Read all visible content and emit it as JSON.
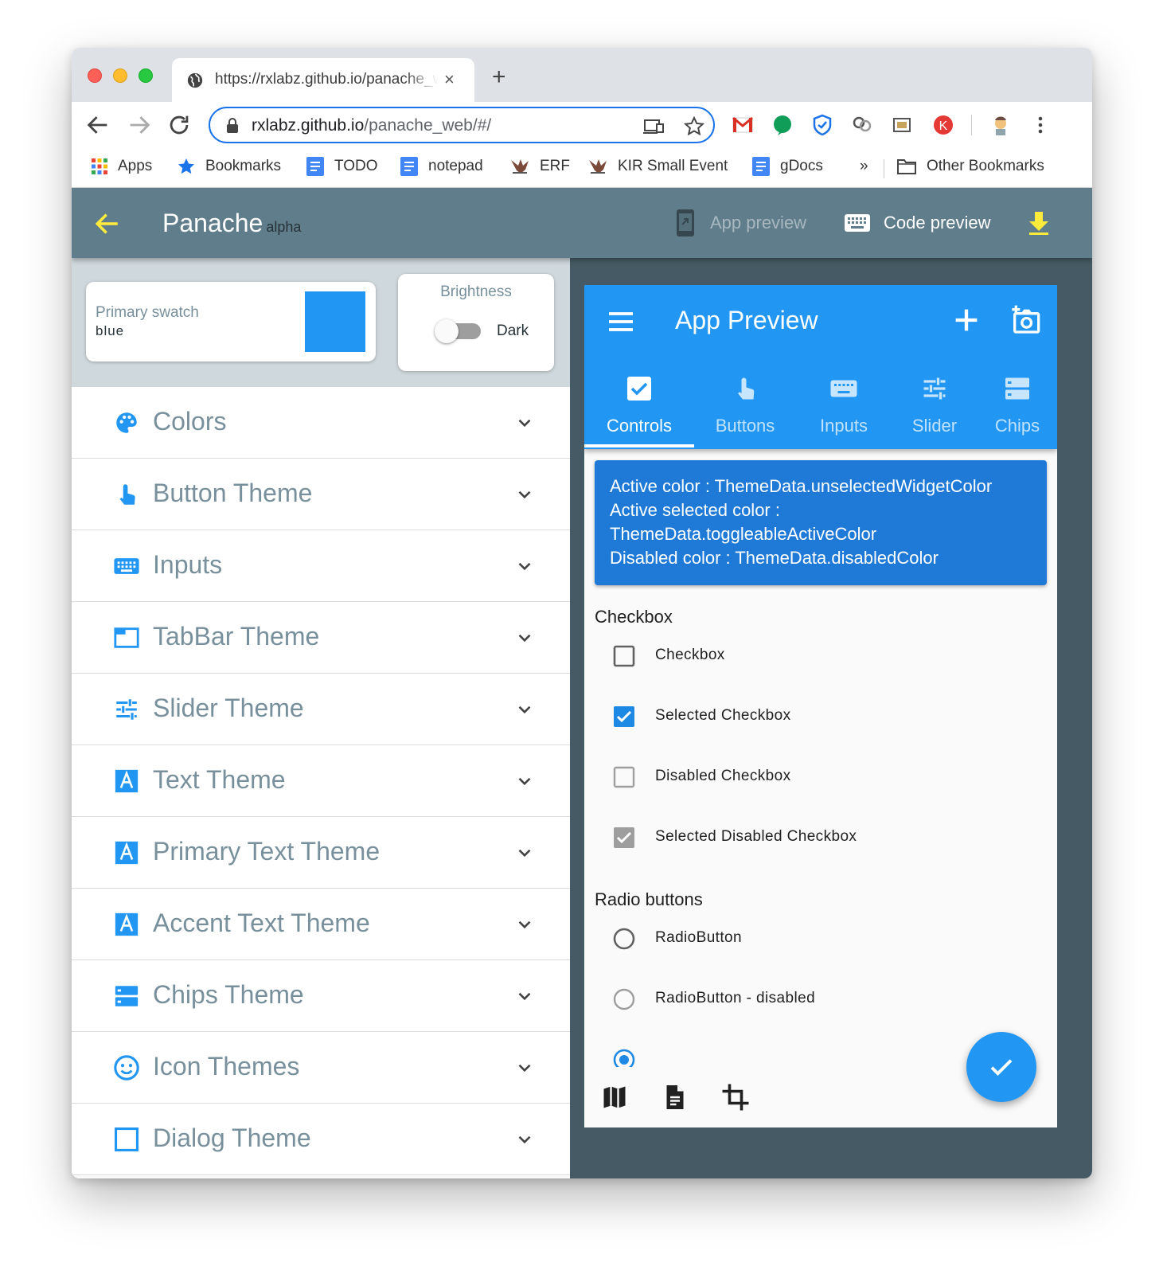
{
  "browser": {
    "tab_title": "https://rxlabz.github.io/panache_web/#/",
    "tab_close": "×",
    "new_tab": "+",
    "url_host": "rxlabz.github.io",
    "url_path": "/panache_web/#/"
  },
  "bookmarks": {
    "items": [
      "Apps",
      "Bookmarks",
      "TODO",
      "notepad",
      "ERF",
      "KIR Small Event",
      "gDocs"
    ],
    "overflow": "»",
    "other": "Other Bookmarks"
  },
  "appbar": {
    "title": "Panache",
    "subtitle": "alpha",
    "app_preview": "App preview",
    "code_preview": "Code preview",
    "accent_color": "#ffeb3b"
  },
  "swatch": {
    "label": "Primary swatch",
    "value": "blue",
    "color": "#2196f3"
  },
  "brightness": {
    "label": "Brightness",
    "value": "Dark"
  },
  "menu": {
    "items": [
      {
        "label": "Colors",
        "icon": "palette-icon"
      },
      {
        "label": "Button Theme",
        "icon": "touch-app-icon"
      },
      {
        "label": "Inputs",
        "icon": "keyboard-icon"
      },
      {
        "label": "TabBar Theme",
        "icon": "tab-icon"
      },
      {
        "label": "Slider Theme",
        "icon": "tune-icon"
      },
      {
        "label": "Text Theme",
        "icon": "text-icon"
      },
      {
        "label": "Primary Text Theme",
        "icon": "text-icon"
      },
      {
        "label": "Accent Text Theme",
        "icon": "text-icon"
      },
      {
        "label": "Chips Theme",
        "icon": "chips-icon"
      },
      {
        "label": "Icon Themes",
        "icon": "smiley-icon"
      },
      {
        "label": "Dialog Theme",
        "icon": "dialog-icon"
      }
    ]
  },
  "preview": {
    "title": "App Preview",
    "tabs": [
      "Controls",
      "Buttons",
      "Inputs",
      "Slider",
      "Chips"
    ],
    "info_lines": [
      "Active color : ThemeData.unselectedWidgetColor",
      "Active selected color :",
      "ThemeData.toggleableActiveColor",
      "Disabled color : ThemeData.disabledColor"
    ],
    "checkbox_section": "Checkbox",
    "checkboxes": [
      "Checkbox",
      "Selected Checkbox",
      "Disabled Checkbox",
      "Selected Disabled Checkbox"
    ],
    "radio_section": "Radio buttons",
    "radios": [
      "RadioButton",
      "RadioButton - disabled"
    ]
  }
}
